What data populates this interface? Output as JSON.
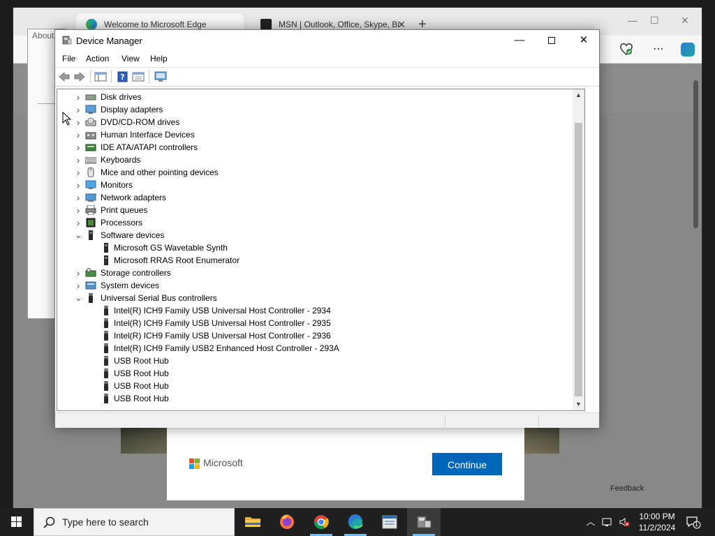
{
  "edge": {
    "tabs": [
      {
        "title": "Welcome to Microsoft Edge"
      },
      {
        "title": "MSN | Outlook, Office, Skype, Bi"
      }
    ],
    "new_tab": "+",
    "about_panel_label": "About",
    "dialog": {
      "brand": "Microsoft",
      "continue_label": "Continue"
    },
    "feedback_label": "Feedback"
  },
  "device_manager": {
    "title": "Device Manager",
    "menu": [
      "File",
      "Action",
      "View",
      "Help"
    ],
    "window_controls": {
      "minimize": "—",
      "close": "✕"
    },
    "tree": [
      {
        "type": "category",
        "label": "Disk drives",
        "expanded": false,
        "icon": "disk-drive-icon"
      },
      {
        "type": "category",
        "label": "Display adapters",
        "expanded": false,
        "icon": "display-adapter-icon"
      },
      {
        "type": "category",
        "label": "DVD/CD-ROM drives",
        "expanded": false,
        "icon": "dvd-drive-icon"
      },
      {
        "type": "category",
        "label": "Human Interface Devices",
        "expanded": false,
        "icon": "hid-icon"
      },
      {
        "type": "category",
        "label": "IDE ATA/ATAPI controllers",
        "expanded": false,
        "icon": "ide-controller-icon"
      },
      {
        "type": "category",
        "label": "Keyboards",
        "expanded": false,
        "icon": "keyboard-icon"
      },
      {
        "type": "category",
        "label": "Mice and other pointing devices",
        "expanded": false,
        "icon": "mouse-icon"
      },
      {
        "type": "category",
        "label": "Monitors",
        "expanded": false,
        "icon": "monitor-icon"
      },
      {
        "type": "category",
        "label": "Network adapters",
        "expanded": false,
        "icon": "network-adapter-icon"
      },
      {
        "type": "category",
        "label": "Print queues",
        "expanded": false,
        "icon": "printer-icon"
      },
      {
        "type": "category",
        "label": "Processors",
        "expanded": false,
        "icon": "processor-icon"
      },
      {
        "type": "category",
        "label": "Software devices",
        "expanded": true,
        "icon": "software-device-icon"
      },
      {
        "type": "device",
        "label": "Microsoft GS Wavetable Synth",
        "icon": "software-device-icon"
      },
      {
        "type": "device",
        "label": "Microsoft RRAS Root Enumerator",
        "icon": "software-device-icon"
      },
      {
        "type": "category",
        "label": "Storage controllers",
        "expanded": false,
        "icon": "storage-controller-icon"
      },
      {
        "type": "category",
        "label": "System devices",
        "expanded": false,
        "icon": "system-device-icon"
      },
      {
        "type": "category",
        "label": "Universal Serial Bus controllers",
        "expanded": true,
        "icon": "usb-icon"
      },
      {
        "type": "device",
        "label": "Intel(R) ICH9 Family USB Universal Host Controller - 2934",
        "icon": "usb-icon"
      },
      {
        "type": "device",
        "label": "Intel(R) ICH9 Family USB Universal Host Controller - 2935",
        "icon": "usb-icon"
      },
      {
        "type": "device",
        "label": "Intel(R) ICH9 Family USB Universal Host Controller - 2936",
        "icon": "usb-icon"
      },
      {
        "type": "device",
        "label": "Intel(R) ICH9 Family USB2 Enhanced Host Controller - 293A",
        "icon": "usb-icon"
      },
      {
        "type": "device",
        "label": "USB Root Hub",
        "icon": "usb-icon"
      },
      {
        "type": "device",
        "label": "USB Root Hub",
        "icon": "usb-icon"
      },
      {
        "type": "device",
        "label": "USB Root Hub",
        "icon": "usb-icon"
      },
      {
        "type": "device",
        "label": "USB Root Hub",
        "icon": "usb-icon"
      }
    ]
  },
  "taskbar": {
    "search_placeholder": "Type here to search",
    "apps": [
      "file-explorer-icon",
      "firefox-icon",
      "chrome-icon",
      "edge-icon",
      "notepad-icon",
      "device-manager-icon"
    ],
    "time": "10:00 PM",
    "date": "11/2/2024",
    "notification_count": "1"
  },
  "colors": {
    "accent": "#0067b8",
    "taskbar": "#1f1f1f",
    "taskbar_indicator": "#76b9ed"
  }
}
